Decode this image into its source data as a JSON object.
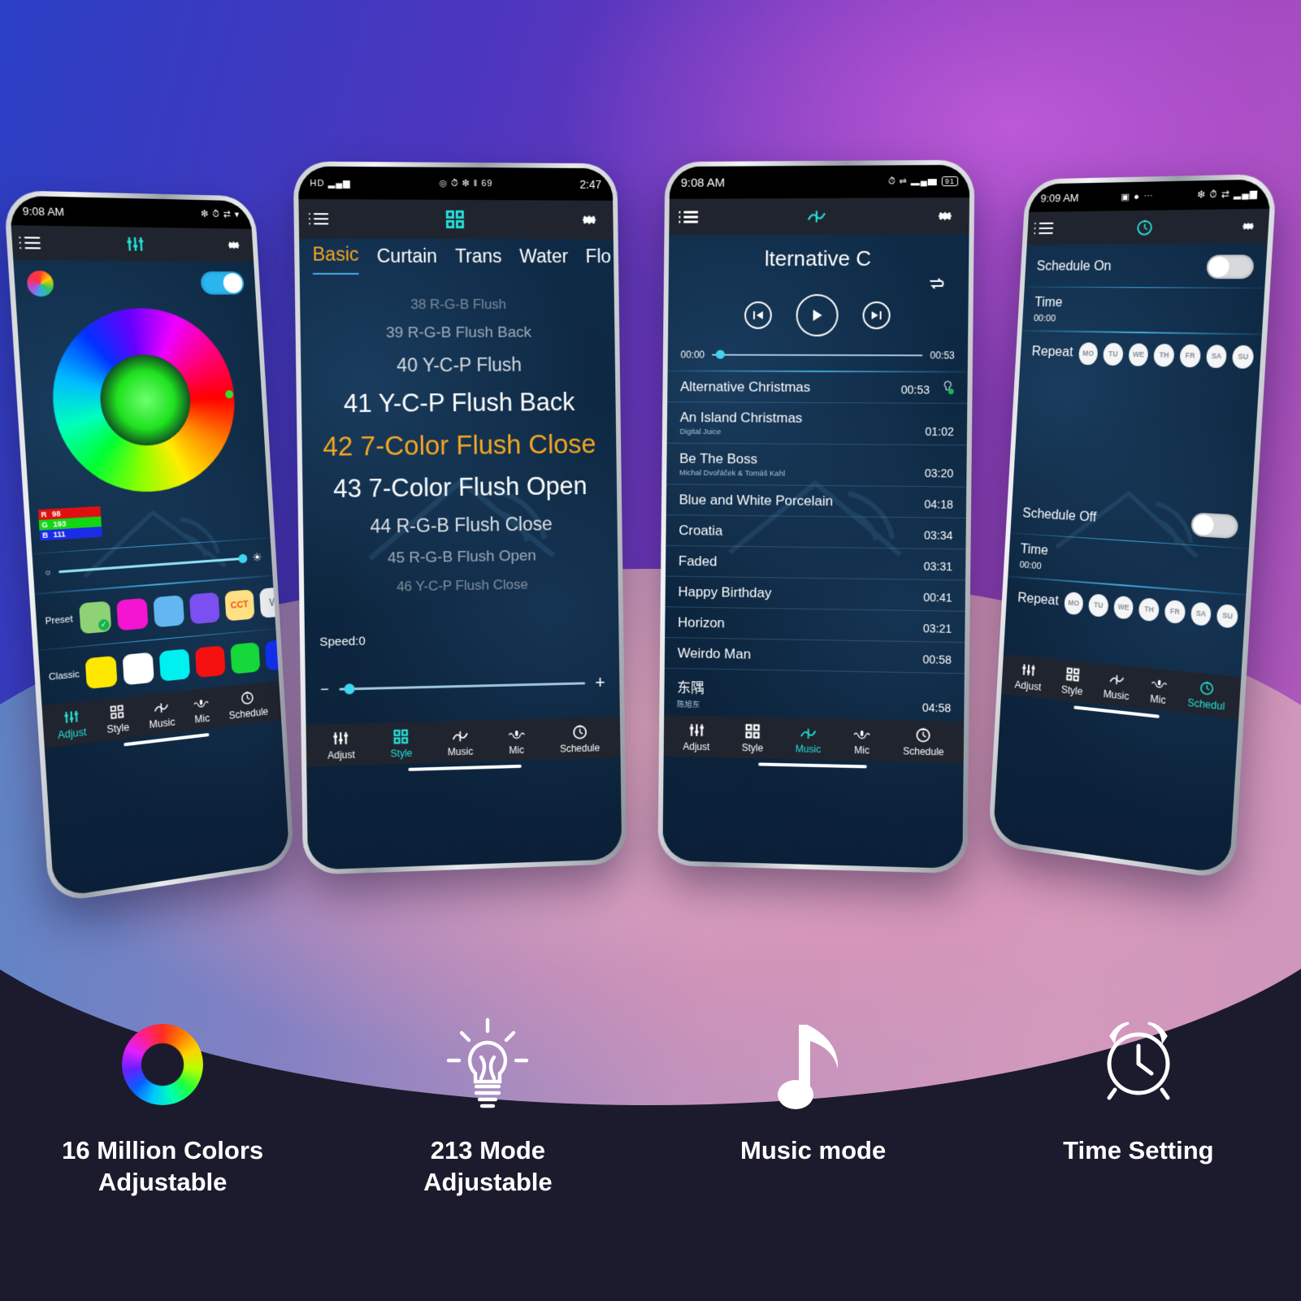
{
  "theme": {
    "accent_cyan": "#23e0d8",
    "accent_orange": "#f5a623",
    "bg_dark": "#1c1b2e",
    "app_blue": "#0d2740"
  },
  "phone1": {
    "status": {
      "time": "9:08 AM",
      "icons": "❇ ⏱ ⇄ ▾"
    },
    "appbar": {
      "menu_icon": "list-icon",
      "title_icon": "sliders-icon",
      "settings_icon": "gear-icon"
    },
    "power_toggle": "on",
    "color_picker_button": "color-wheel-button",
    "rgb": {
      "r_label": "R",
      "r_value": "98",
      "g_label": "G",
      "g_value": "193",
      "b_label": "B",
      "b_value": "111"
    },
    "brightness": {
      "min_icon": "low-brightness-icon",
      "max_icon": "high-brightness-icon",
      "value": 96
    },
    "preset": {
      "label": "Preset",
      "swatches": [
        "#8fd275",
        "#f315d1",
        "#63b7f0",
        "#7b4ff0",
        "#ffe082",
        "#eceff1"
      ],
      "cct_label": "CCT",
      "w_label": "W",
      "selected_index": 0
    },
    "classic": {
      "label": "Classic",
      "swatches": [
        "#ffe800",
        "#ffffff",
        "#00f0f0",
        "#f51010",
        "#16d83a",
        "#1030f0"
      ]
    },
    "nav": [
      {
        "label": "Adjust",
        "icon": "sliders-icon",
        "active": true
      },
      {
        "label": "Style",
        "icon": "grid-icon",
        "active": false
      },
      {
        "label": "Music",
        "icon": "wave-icon",
        "active": false
      },
      {
        "label": "Mic",
        "icon": "mic-icon",
        "active": false
      },
      {
        "label": "Schedule",
        "icon": "clock-icon",
        "active": false
      }
    ]
  },
  "phone2": {
    "status": {
      "time": "2:47",
      "left_icons": "HD ▂▄▆",
      "right_icons": "◎ ⏱ ❇ ‖ 69"
    },
    "appbar": {
      "menu_icon": "list-icon",
      "title_icon": "grid-icon",
      "settings_icon": "gear-icon"
    },
    "tabs": [
      {
        "label": "Basic",
        "active": true
      },
      {
        "label": "Curtain",
        "active": false
      },
      {
        "label": "Trans",
        "active": false
      },
      {
        "label": "Water",
        "active": false
      },
      {
        "label": "Flo",
        "active": false
      }
    ],
    "tab_more_icon": "chevron-right-icon",
    "modes": [
      {
        "label": "38 R-G-B Flush",
        "size": 17,
        "opacity": 0.42,
        "selected": false
      },
      {
        "label": "39 R-G-B Flush Back",
        "size": 19,
        "opacity": 0.55,
        "selected": false
      },
      {
        "label": "40 Y-C-P Flush",
        "size": 23,
        "opacity": 0.78,
        "selected": false
      },
      {
        "label": "41 Y-C-P Flush Back",
        "size": 31,
        "opacity": 1,
        "selected": false
      },
      {
        "label": "42 7-Color Flush Close",
        "size": 33,
        "opacity": 1,
        "selected": true
      },
      {
        "label": "43 7-Color Flush Open",
        "size": 31,
        "opacity": 1,
        "selected": false
      },
      {
        "label": "44 R-G-B Flush Close",
        "size": 23,
        "opacity": 0.8,
        "selected": false
      },
      {
        "label": "45 R-G-B Flush Open",
        "size": 19,
        "opacity": 0.55,
        "selected": false
      },
      {
        "label": "46 Y-C-P Flush Close",
        "size": 17,
        "opacity": 0.42,
        "selected": false
      }
    ],
    "speed": {
      "label": "Speed:0",
      "value": 2,
      "minus": "−",
      "plus": "+"
    },
    "nav": [
      {
        "label": "Adjust",
        "icon": "sliders-icon",
        "active": false
      },
      {
        "label": "Style",
        "icon": "grid-icon",
        "active": true
      },
      {
        "label": "Music",
        "icon": "wave-icon",
        "active": false
      },
      {
        "label": "Mic",
        "icon": "mic-icon",
        "active": false
      },
      {
        "label": "Schedule",
        "icon": "clock-icon",
        "active": false
      }
    ]
  },
  "phone3": {
    "status": {
      "time": "9:08 AM",
      "icons": "⏱ ⇄ ▂▄▆",
      "battery": "91"
    },
    "appbar": {
      "menu_icon": "list-icon",
      "title_icon": "wave-icon",
      "settings_icon": "gear-icon"
    },
    "now_playing": "lternative C",
    "repeat_icon": "repeat-icon",
    "transport": {
      "prev": "previous-icon",
      "play": "play-icon",
      "next": "next-icon"
    },
    "progress": {
      "current": "00:00",
      "total": "00:53",
      "value": 2
    },
    "songs": [
      {
        "title": "Alternative Christmas",
        "artist": "",
        "time": "00:53",
        "badge": "playing-badge-icon"
      },
      {
        "title": "An Island Christmas",
        "artist": "Digital Juice",
        "time": "01:02"
      },
      {
        "title": "Be The Boss",
        "artist": "Michal Dvořáček & Tomáš Kahl",
        "time": "03:20"
      },
      {
        "title": "Blue and White Porcelain",
        "artist": "",
        "time": "04:18"
      },
      {
        "title": "Croatia",
        "artist": "",
        "time": "03:34"
      },
      {
        "title": "Faded",
        "artist": "",
        "time": "03:31"
      },
      {
        "title": "Happy Birthday",
        "artist": "",
        "time": "00:41"
      },
      {
        "title": "Horizon",
        "artist": "",
        "time": "03:21"
      },
      {
        "title": "Weirdo Man",
        "artist": "",
        "time": "00:58"
      },
      {
        "title": "东隅",
        "artist": "陈旭东",
        "time": "04:58"
      }
    ],
    "nav": [
      {
        "label": "Adjust",
        "icon": "sliders-icon",
        "active": false
      },
      {
        "label": "Style",
        "icon": "grid-icon",
        "active": false
      },
      {
        "label": "Music",
        "icon": "wave-icon",
        "active": true
      },
      {
        "label": "Mic",
        "icon": "mic-icon",
        "active": false
      },
      {
        "label": "Schedule",
        "icon": "clock-icon",
        "active": false
      }
    ]
  },
  "phone4": {
    "status": {
      "time": "9:09 AM",
      "left_icons": "▣ ● ⋯",
      "right_icons": "❇ ⏱ ⇄ ▂▄▆"
    },
    "appbar": {
      "menu_icon": "list-icon",
      "title_icon": "clock-icon",
      "settings_icon": "gear-icon"
    },
    "schedule_on": {
      "label": "Schedule On",
      "toggle": "off",
      "time_label": "Time",
      "time_value": "00:00",
      "repeat_label": "Repeat",
      "days": [
        "MO",
        "TU",
        "WE",
        "TH",
        "FR",
        "SA",
        "SU"
      ]
    },
    "schedule_off": {
      "label": "Schedule Off",
      "toggle": "off",
      "time_label": "Time",
      "time_value": "00:00",
      "repeat_label": "Repeat",
      "days": [
        "MO",
        "TU",
        "WE",
        "TH",
        "FR",
        "SA",
        "SU"
      ]
    },
    "nav": [
      {
        "label": "Adjust",
        "icon": "sliders-icon",
        "active": false
      },
      {
        "label": "Style",
        "icon": "grid-icon",
        "active": false
      },
      {
        "label": "Music",
        "icon": "wave-icon",
        "active": false
      },
      {
        "label": "Mic",
        "icon": "mic-icon",
        "active": false
      },
      {
        "label": "Schedul",
        "icon": "clock-icon",
        "active": true
      }
    ]
  },
  "features": [
    {
      "icon": "color-ring-icon",
      "label": "16 Million Colors\nAdjustable"
    },
    {
      "icon": "lightbulb-icon",
      "label": "213 Mode\nAdjustable"
    },
    {
      "icon": "music-note-icon",
      "label": "Music mode"
    },
    {
      "icon": "alarm-clock-icon",
      "label": "Time Setting"
    }
  ]
}
